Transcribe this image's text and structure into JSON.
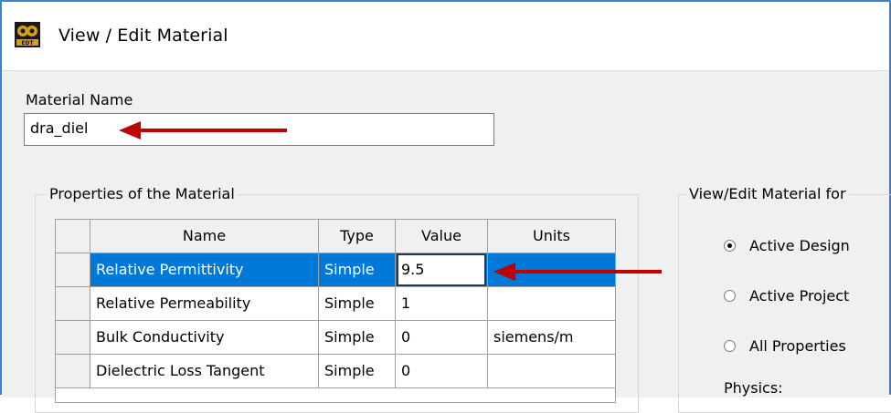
{
  "window": {
    "title": "View / Edit Material"
  },
  "material": {
    "name_label": "Material Name",
    "name_value": "dra_diel"
  },
  "properties": {
    "group_label": "Properties of the Material",
    "columns": [
      "Name",
      "Type",
      "Value",
      "Units"
    ],
    "rows": [
      {
        "name": "Relative Permittivity",
        "type": "Simple",
        "value": "9.5",
        "units": ""
      },
      {
        "name": "Relative Permeability",
        "type": "Simple",
        "value": "1",
        "units": ""
      },
      {
        "name": "Bulk Conductivity",
        "type": "Simple",
        "value": "0",
        "units": "siemens/m"
      },
      {
        "name": "Dielectric Loss Tangent",
        "type": "Simple",
        "value": "0",
        "units": ""
      }
    ],
    "selected_row": 0
  },
  "view_edit_for": {
    "group_label": "View/Edit Material for",
    "options": [
      {
        "label": "Active Design",
        "selected": true
      },
      {
        "label": "Active Project",
        "selected": false
      },
      {
        "label": "All Properties",
        "selected": false
      }
    ],
    "physics_label": "Physics:"
  },
  "colors": {
    "selection": "#0078d7",
    "annotation_arrow": "#c00000",
    "window_border": "#3c7fd8"
  },
  "icons": {
    "app": "edit-material-app-icon",
    "annotation": "red-arrow-icon"
  }
}
